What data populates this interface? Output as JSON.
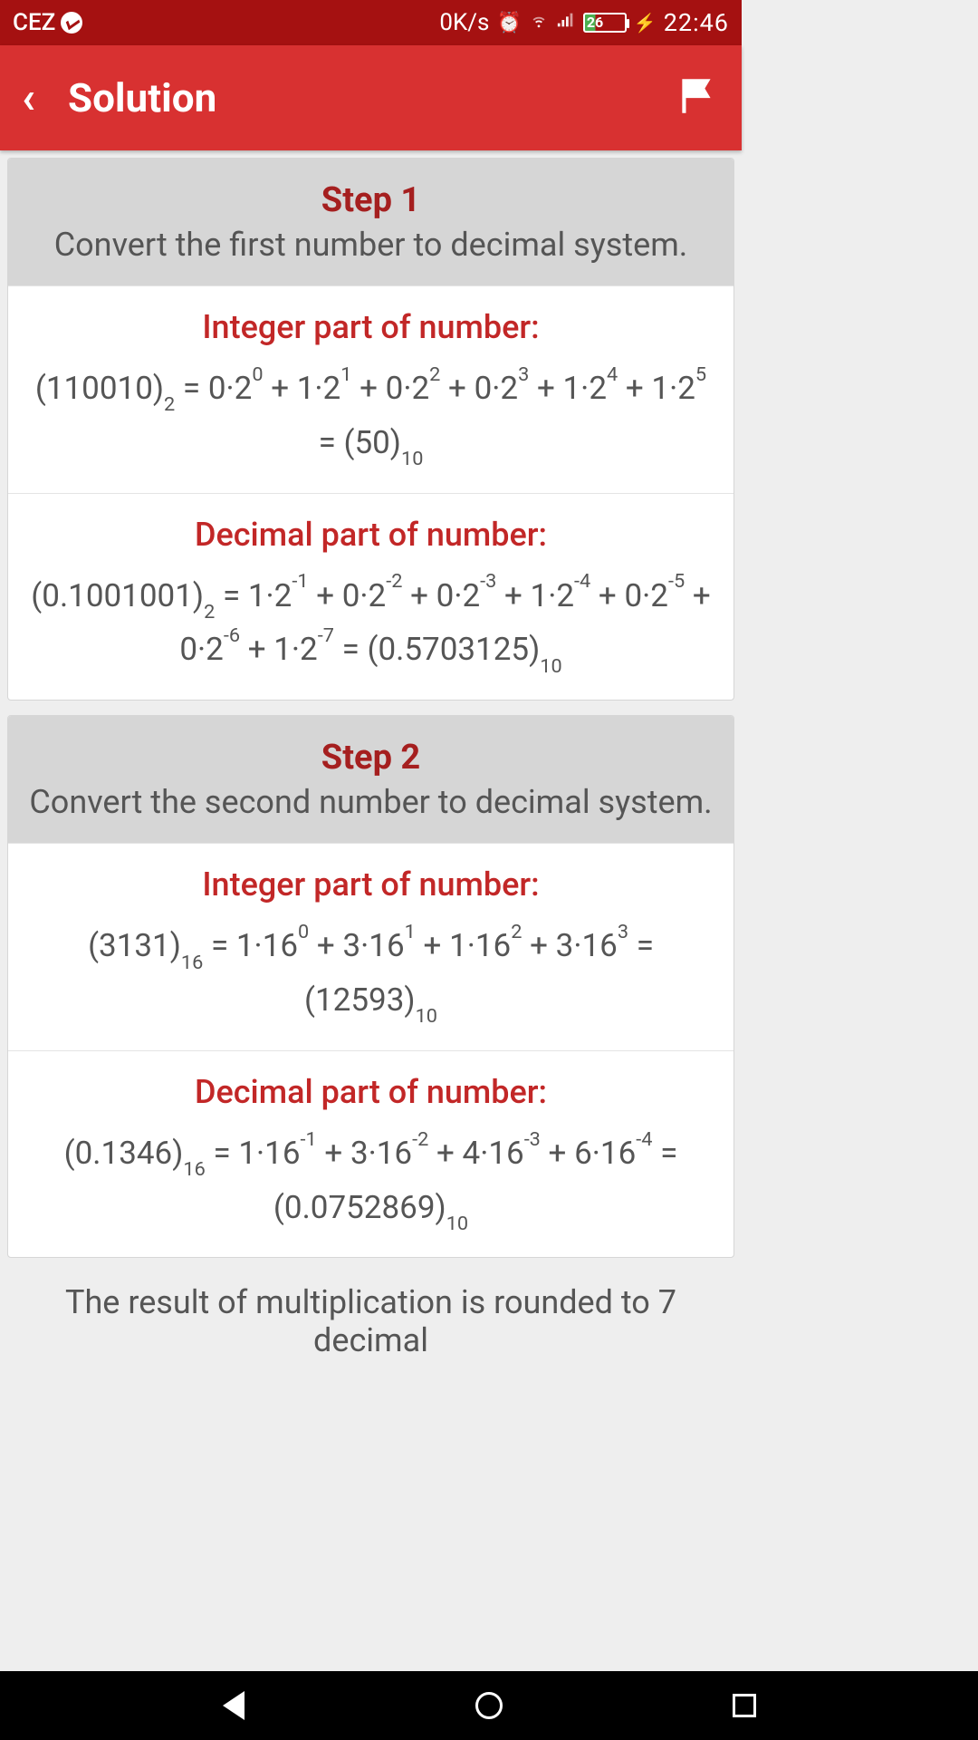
{
  "status": {
    "carrier": "CEZ",
    "net_speed": "0K/s",
    "battery_pct": "26",
    "time": "22:46"
  },
  "appbar": {
    "title": "Solution"
  },
  "steps": [
    {
      "title": "Step 1",
      "desc": "Convert the first number to decimal system.",
      "sections": [
        {
          "label": "Integer part of number:",
          "expr_html": "(110010)<span class='sub'>2</span> = 0·2<span class='sup'>0</span> + 1·2<span class='sup'>1</span> + 0·2<span class='sup'>2</span> + 0·2<span class='sup'>3</span> + 1·2<span class='sup'>4</span> + 1·2<span class='sup'>5</span> = (50)<span class='sub'>10</span>"
        },
        {
          "label": "Decimal part of number:",
          "expr_html": "(0.1001001)<span class='sub'>2</span> = 1·2<span class='sup'>-1</span> + 0·2<span class='sup'>-2</span> + 0·2<span class='sup'>-3</span> + 1·2<span class='sup'>-4</span> + 0·2<span class='sup'>-5</span> + 0·2<span class='sup'>-6</span> + 1·2<span class='sup'>-7</span> = (0.5703125)<span class='sub'>10</span>"
        }
      ]
    },
    {
      "title": "Step 2",
      "desc": "Convert the second number to decimal system.",
      "sections": [
        {
          "label": "Integer part of number:",
          "expr_html": "(3131)<span class='sub'>16</span> = 1·16<span class='sup'>0</span> + 3·16<span class='sup'>1</span> + 1·16<span class='sup'>2</span> + 3·16<span class='sup'>3</span> = (12593)<span class='sub'>10</span>"
        },
        {
          "label": "Decimal part of number:",
          "expr_html": "(0.1346)<span class='sub'>16</span> = 1·16<span class='sup'>-1</span> + 3·16<span class='sup'>-2</span> + 4·16<span class='sup'>-3</span> + 6·16<span class='sup'>-4</span> = (0.0752869)<span class='sub'>10</span>"
        }
      ]
    }
  ],
  "tail_text": "The result of multiplication is rounded to 7 decimal"
}
